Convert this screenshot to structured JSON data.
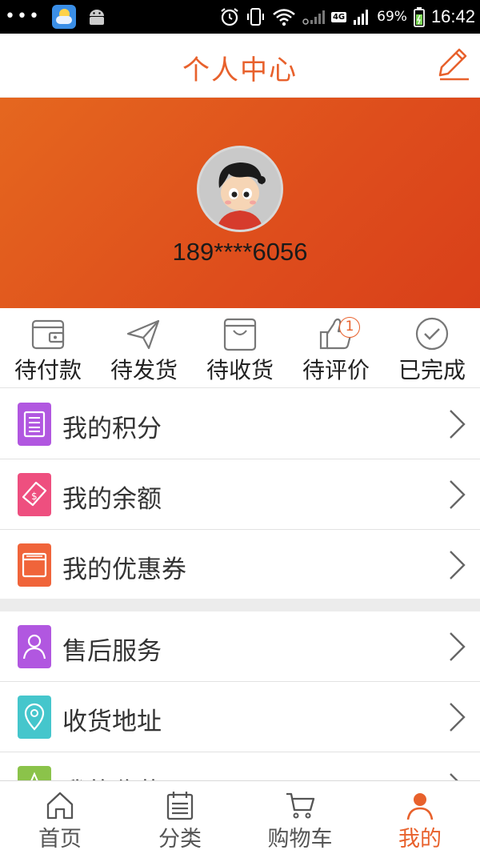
{
  "status_bar": {
    "dots": "•••",
    "battery_percent": "69%",
    "network": "4G",
    "time": "16:42"
  },
  "header": {
    "title": "个人中心"
  },
  "profile": {
    "phone": "189****6056"
  },
  "orders": [
    {
      "label": "待付款",
      "icon": "wallet-icon"
    },
    {
      "label": "待发货",
      "icon": "paper-plane-icon"
    },
    {
      "label": "待收货",
      "icon": "box-icon"
    },
    {
      "label": "待评价",
      "icon": "thumbs-up-icon",
      "badge": "1"
    },
    {
      "label": "已完成",
      "icon": "check-circle-icon"
    }
  ],
  "menu_group_1": [
    {
      "label": "我的积分",
      "icon": "points-list-icon",
      "color": "#b157e0"
    },
    {
      "label": "我的余额",
      "icon": "balance-ticket-icon",
      "color": "#ee4f7f"
    },
    {
      "label": "我的优惠券",
      "icon": "coupon-icon",
      "color": "#f0643a"
    }
  ],
  "menu_group_2": [
    {
      "label": "售后服务",
      "icon": "user-service-icon",
      "color": "#b157e0"
    },
    {
      "label": "收货地址",
      "icon": "location-pin-icon",
      "color": "#45c6cc"
    },
    {
      "label": "我的收藏",
      "icon": "star-icon",
      "color": "#8bc34a"
    }
  ],
  "bottom_nav": [
    {
      "label": "首页",
      "icon": "home-icon"
    },
    {
      "label": "分类",
      "icon": "category-icon"
    },
    {
      "label": "购物车",
      "icon": "cart-icon"
    },
    {
      "label": "我的",
      "icon": "profile-icon",
      "active": true
    }
  ],
  "colors": {
    "accent": "#e8612c",
    "banner_start": "#e5671f",
    "banner_end": "#d9401a"
  }
}
